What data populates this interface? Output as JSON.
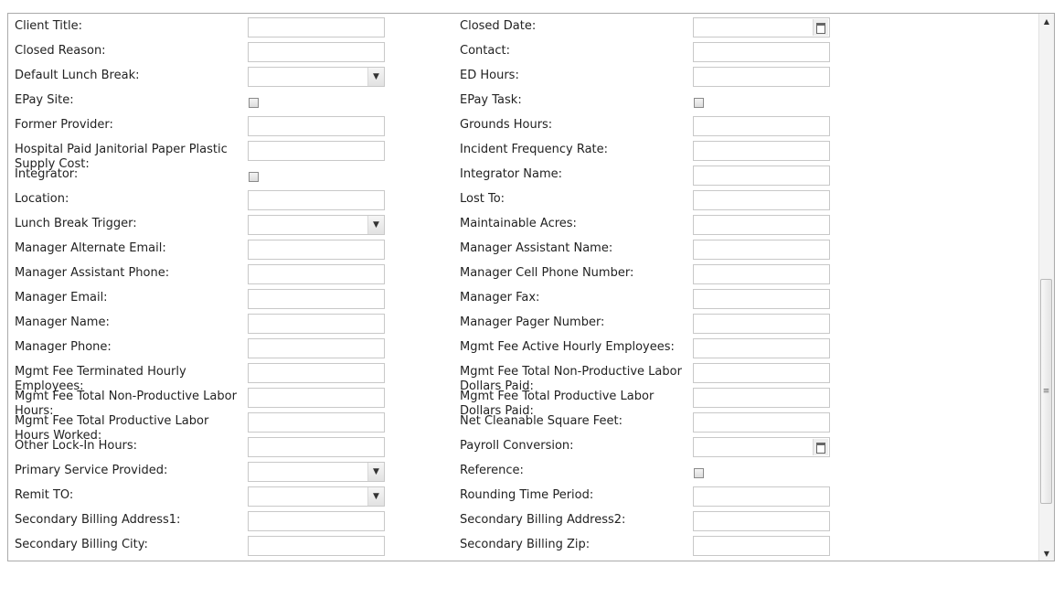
{
  "rows": [
    {
      "left": {
        "label": "Client Title:",
        "type": "text",
        "value": ""
      },
      "right": {
        "label": "Closed Date:",
        "type": "date",
        "value": ""
      }
    },
    {
      "left": {
        "label": "Closed Reason:",
        "type": "text",
        "value": ""
      },
      "right": {
        "label": "Contact:",
        "type": "text",
        "value": ""
      }
    },
    {
      "left": {
        "label": "Default Lunch Break:",
        "type": "select",
        "value": ""
      },
      "right": {
        "label": "ED Hours:",
        "type": "text",
        "value": ""
      }
    },
    {
      "left": {
        "label": "EPay Site:",
        "type": "checkbox",
        "value": ""
      },
      "right": {
        "label": "EPay Task:",
        "type": "checkbox",
        "value": ""
      }
    },
    {
      "left": {
        "label": "Former Provider:",
        "type": "text",
        "value": ""
      },
      "right": {
        "label": "Grounds Hours:",
        "type": "text",
        "value": ""
      }
    },
    {
      "left": {
        "label": "Hospital Paid Janitorial Paper Plastic Supply Cost:",
        "type": "text",
        "value": ""
      },
      "right": {
        "label": "Incident Frequency Rate:",
        "type": "text",
        "value": ""
      }
    },
    {
      "left": {
        "label": "Integrator:",
        "type": "checkbox",
        "value": ""
      },
      "right": {
        "label": "Integrator Name:",
        "type": "text",
        "value": ""
      }
    },
    {
      "left": {
        "label": "Location:",
        "type": "text",
        "value": ""
      },
      "right": {
        "label": "Lost To:",
        "type": "text",
        "value": ""
      }
    },
    {
      "left": {
        "label": "Lunch Break Trigger:",
        "type": "select",
        "value": ""
      },
      "right": {
        "label": "Maintainable Acres:",
        "type": "text",
        "value": ""
      }
    },
    {
      "left": {
        "label": "Manager Alternate Email:",
        "type": "text",
        "value": ""
      },
      "right": {
        "label": "Manager Assistant Name:",
        "type": "text",
        "value": ""
      }
    },
    {
      "left": {
        "label": "Manager Assistant Phone:",
        "type": "text",
        "value": ""
      },
      "right": {
        "label": "Manager Cell Phone Number:",
        "type": "text",
        "value": ""
      }
    },
    {
      "left": {
        "label": "Manager Email:",
        "type": "text",
        "value": ""
      },
      "right": {
        "label": "Manager Fax:",
        "type": "text",
        "value": ""
      }
    },
    {
      "left": {
        "label": "Manager Name:",
        "type": "text",
        "value": ""
      },
      "right": {
        "label": "Manager Pager Number:",
        "type": "text",
        "value": ""
      }
    },
    {
      "left": {
        "label": "Manager Phone:",
        "type": "text",
        "value": ""
      },
      "right": {
        "label": "Mgmt Fee Active Hourly Employees:",
        "type": "text",
        "value": ""
      }
    },
    {
      "left": {
        "label": "Mgmt Fee Terminated Hourly Employees:",
        "type": "text",
        "value": ""
      },
      "right": {
        "label": "Mgmt Fee Total Non-Productive Labor Dollars Paid:",
        "type": "text",
        "value": ""
      }
    },
    {
      "left": {
        "label": "Mgmt Fee Total Non-Productive Labor Hours:",
        "type": "text",
        "value": ""
      },
      "right": {
        "label": "Mgmt Fee Total Productive Labor Dollars Paid:",
        "type": "text",
        "value": ""
      }
    },
    {
      "left": {
        "label": "Mgmt Fee Total Productive Labor Hours Worked:",
        "type": "text",
        "value": ""
      },
      "right": {
        "label": "Net Cleanable Square Feet:",
        "type": "text",
        "value": ""
      }
    },
    {
      "left": {
        "label": "Other Lock-In Hours:",
        "type": "text",
        "value": ""
      },
      "right": {
        "label": "Payroll Conversion:",
        "type": "date",
        "value": ""
      }
    },
    {
      "left": {
        "label": "Primary Service Provided:",
        "type": "select",
        "value": ""
      },
      "right": {
        "label": "Reference:",
        "type": "checkbox",
        "value": ""
      }
    },
    {
      "left": {
        "label": "Remit TO:",
        "type": "select",
        "value": ""
      },
      "right": {
        "label": "Rounding Time Period:",
        "type": "text",
        "value": ""
      }
    },
    {
      "left": {
        "label": "Secondary Billing Address1:",
        "type": "text",
        "value": ""
      },
      "right": {
        "label": "Secondary Billing Address2:",
        "type": "text",
        "value": ""
      }
    },
    {
      "left": {
        "label": "Secondary Billing City:",
        "type": "text",
        "value": ""
      },
      "right": {
        "label": "Secondary Billing Zip:",
        "type": "text",
        "value": ""
      }
    }
  ],
  "icons": {
    "select_arrow": "chevron-down-icon",
    "date_picker": "calendar-icon",
    "scroll_up": "arrow-up-icon",
    "scroll_down": "arrow-down-icon",
    "scroll_grip": "grip-icon"
  },
  "colors": {
    "border": "#c8c8c8",
    "panel_border": "#aaaaaa",
    "text": "#222222"
  }
}
